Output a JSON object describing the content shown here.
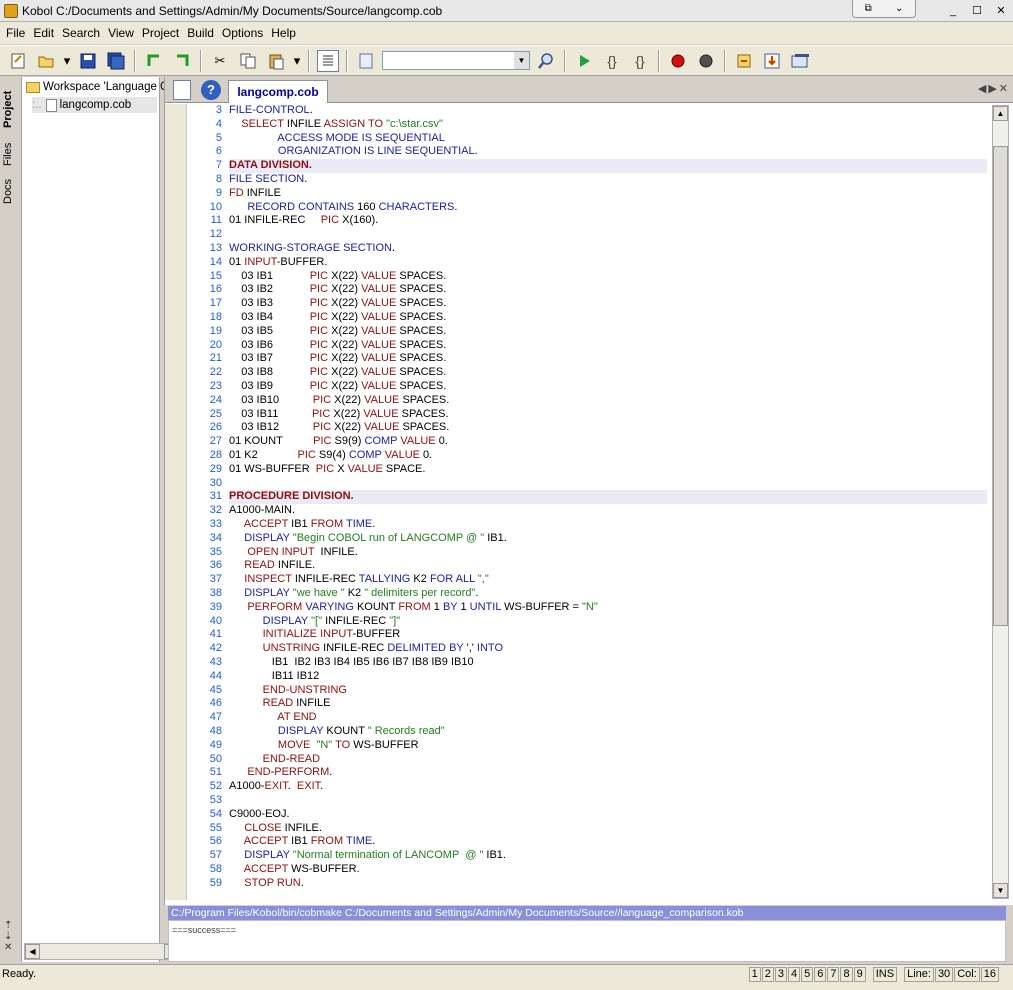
{
  "window": {
    "title": "Kobol C:/Documents and Settings/Admin/My Documents/Source/langcomp.cob",
    "min": "_",
    "max": "☐",
    "close": "✕"
  },
  "menu": [
    "File",
    "Edit",
    "Search",
    "View",
    "Project",
    "Build",
    "Options",
    "Help"
  ],
  "search": {
    "value": ""
  },
  "side_tabs": {
    "project": "Project",
    "files": "Files",
    "docs": "Docs"
  },
  "tree": {
    "workspace": "Workspace 'Language C",
    "file": "langcomp.cob"
  },
  "editor": {
    "tab_label": "langcomp.cob",
    "lines": [
      {
        "n": "3",
        "t": "FILE-CONTROL."
      },
      {
        "n": "4",
        "t": "    SELECT INFILE ASSIGN TO \"c:\\star.csv\""
      },
      {
        "n": "5",
        "t": "                ACCESS MODE IS SEQUENTIAL"
      },
      {
        "n": "6",
        "t": "                ORGANIZATION IS LINE SEQUENTIAL."
      },
      {
        "n": "7",
        "t": "DATA DIVISION."
      },
      {
        "n": "8",
        "t": "FILE SECTION."
      },
      {
        "n": "9",
        "t": "FD INFILE"
      },
      {
        "n": "10",
        "t": "      RECORD CONTAINS 160 CHARACTERS."
      },
      {
        "n": "11",
        "t": "01 INFILE-REC     PIC X(160)."
      },
      {
        "n": "12",
        "t": ""
      },
      {
        "n": "13",
        "t": "WORKING-STORAGE SECTION."
      },
      {
        "n": "14",
        "t": "01 INPUT-BUFFER."
      },
      {
        "n": "15",
        "t": "    03 IB1            PIC X(22) VALUE SPACES."
      },
      {
        "n": "16",
        "t": "    03 IB2            PIC X(22) VALUE SPACES."
      },
      {
        "n": "17",
        "t": "    03 IB3            PIC X(22) VALUE SPACES."
      },
      {
        "n": "18",
        "t": "    03 IB4            PIC X(22) VALUE SPACES."
      },
      {
        "n": "19",
        "t": "    03 IB5            PIC X(22) VALUE SPACES."
      },
      {
        "n": "20",
        "t": "    03 IB6            PIC X(22) VALUE SPACES."
      },
      {
        "n": "21",
        "t": "    03 IB7            PIC X(22) VALUE SPACES."
      },
      {
        "n": "22",
        "t": "    03 IB8            PIC X(22) VALUE SPACES."
      },
      {
        "n": "23",
        "t": "    03 IB9            PIC X(22) VALUE SPACES."
      },
      {
        "n": "24",
        "t": "    03 IB10           PIC X(22) VALUE SPACES."
      },
      {
        "n": "25",
        "t": "    03 IB11           PIC X(22) VALUE SPACES."
      },
      {
        "n": "26",
        "t": "    03 IB12           PIC X(22) VALUE SPACES."
      },
      {
        "n": "27",
        "t": "01 KOUNT          PIC S9(9) COMP VALUE 0."
      },
      {
        "n": "28",
        "t": "01 K2             PIC S9(4) COMP VALUE 0."
      },
      {
        "n": "29",
        "t": "01 WS-BUFFER  PIC X VALUE SPACE."
      },
      {
        "n": "30",
        "t": ""
      },
      {
        "n": "31",
        "t": "PROCEDURE DIVISION."
      },
      {
        "n": "32",
        "t": "A1000-MAIN."
      },
      {
        "n": "33",
        "t": "     ACCEPT IB1 FROM TIME."
      },
      {
        "n": "34",
        "t": "     DISPLAY \"Begin COBOL run of LANGCOMP @ \" IB1."
      },
      {
        "n": "35",
        "t": "      OPEN INPUT  INFILE."
      },
      {
        "n": "36",
        "t": "     READ INFILE."
      },
      {
        "n": "37",
        "t": "     INSPECT INFILE-REC TALLYING K2 FOR ALL \",\""
      },
      {
        "n": "38",
        "t": "     DISPLAY \"we have \" K2 \" delimiters per record\"."
      },
      {
        "n": "39",
        "t": "      PERFORM VARYING KOUNT FROM 1 BY 1 UNTIL WS-BUFFER = \"N\""
      },
      {
        "n": "40",
        "t": "           DISPLAY \"[\" INFILE-REC \"]\""
      },
      {
        "n": "41",
        "t": "           INITIALIZE INPUT-BUFFER"
      },
      {
        "n": "42",
        "t": "           UNSTRING INFILE-REC DELIMITED BY ',' INTO"
      },
      {
        "n": "43",
        "t": "              IB1  IB2 IB3 IB4 IB5 IB6 IB7 IB8 IB9 IB10"
      },
      {
        "n": "44",
        "t": "              IB11 IB12"
      },
      {
        "n": "45",
        "t": "           END-UNSTRING"
      },
      {
        "n": "46",
        "t": "           READ INFILE"
      },
      {
        "n": "47",
        "t": "                AT END"
      },
      {
        "n": "48",
        "t": "                DISPLAY KOUNT \" Records read\""
      },
      {
        "n": "49",
        "t": "                MOVE  \"N\" TO WS-BUFFER"
      },
      {
        "n": "50",
        "t": "           END-READ"
      },
      {
        "n": "51",
        "t": "      END-PERFORM."
      },
      {
        "n": "52",
        "t": "A1000-EXIT.  EXIT."
      },
      {
        "n": "53",
        "t": ""
      },
      {
        "n": "54",
        "t": "C9000-EOJ."
      },
      {
        "n": "55",
        "t": "     CLOSE INFILE."
      },
      {
        "n": "56",
        "t": "     ACCEPT IB1 FROM TIME."
      },
      {
        "n": "57",
        "t": "     DISPLAY \"Normal termination of LANCOMP  @ \" IB1."
      },
      {
        "n": "58",
        "t": "     ACCEPT WS-BUFFER."
      },
      {
        "n": "59",
        "t": "     STOP RUN."
      }
    ]
  },
  "output": {
    "command": "C:/Program Files/Kobol/bin/cobmake C:/Documents and Settings/Admin/My Documents/Source//language_comparison.kob",
    "result": "===success==="
  },
  "status": {
    "text": "Ready.",
    "bookmarks": [
      "1",
      "2",
      "3",
      "4",
      "5",
      "6",
      "7",
      "8",
      "9"
    ],
    "mode": "INS",
    "line_label": "Line:",
    "line": "30",
    "col_label": "Col:",
    "col": "16"
  }
}
